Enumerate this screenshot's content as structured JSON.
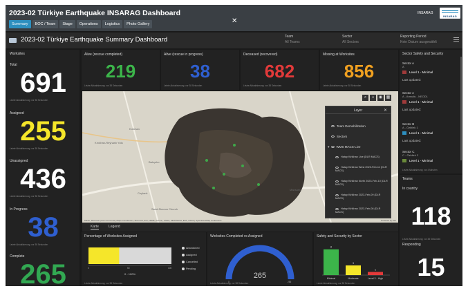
{
  "header": {
    "title": "2023-02 Türkiye Earthquake INSARAG Dashboard",
    "org_label": "INSARAG",
    "logo_text": "INSARAG",
    "tabs": [
      "Summary",
      "BOC / Team",
      "Stage",
      "Operations",
      "Logistics",
      "Photo Gallery"
    ],
    "active_tab": "Summary",
    "close_glyph": "✕"
  },
  "subheader": {
    "title": "2023-02 Türkiye Earthquake Summary Dashboard",
    "filters": [
      {
        "label": "Team",
        "value": "All Teams"
      },
      {
        "label": "Sector",
        "value": "All Sectors"
      },
      {
        "label": "Reporting Period",
        "value": "Kein Datum ausgewählt"
      }
    ]
  },
  "timestamp_text": "Letzte Aktualisierung: vor 38 Sekunden",
  "worksites": {
    "title": "Worksites",
    "blocks": [
      {
        "label": "Total",
        "value": "691",
        "color": "#ffffff"
      },
      {
        "label": "Assigned",
        "value": "255",
        "color": "#f5e62a"
      },
      {
        "label": "Unassigned",
        "value": "436",
        "color": "#ffffff"
      },
      {
        "label": "In Progress",
        "value": "38",
        "color": "#2f5fd0"
      },
      {
        "label": "Complete",
        "value": "265",
        "color": "#32a852"
      }
    ]
  },
  "kpis": [
    {
      "label": "Alive (rescue completed)",
      "value": "219",
      "color": "#3cb54a"
    },
    {
      "label": "Alive (rescue in progress)",
      "value": "38",
      "color": "#2f5fd0"
    },
    {
      "label": "Deceased (recovered)",
      "value": "682",
      "color": "#e23a3a"
    },
    {
      "label": "Missing at Worksites",
      "value": "856",
      "color": "#f0a020"
    }
  ],
  "map": {
    "road_labels": [
      "Kırıkhan",
      "Kırıkhan-Reyhanlı Yolu",
      "Bahçeler",
      "Ceylanlı",
      "Saint-Simeon Church",
      "Mansurlu"
    ],
    "tools": [
      "⌕",
      "⌂",
      "◉",
      "▦"
    ],
    "attribution": "Maxar, Microsoft | Esri Community Maps Contributors, Microsoft, Esri, HERE, Garmin, USGS, METI/NASA, EPA, USDA | OpenStreetMap contributors",
    "powered_by": "Powered by Esri",
    "tabs": [
      "Karte",
      "Legend"
    ],
    "active_tab": "Karte"
  },
  "layer_panel": {
    "title": "Layer",
    "close_glyph": "✕",
    "items": [
      "Team Demobilization",
      "Sectors",
      "WMS MACS-Live"
    ],
    "sub_items": [
      "Hatay Kirikhan Live (DLR MACS)",
      "Hatay Kirikhan West 2023-Feb-11 (DLR MACS)",
      "Hatay Kirikhan North 2023-Feb-10 (DLR MACS)",
      "Hatay Kirikhan 2023-Feb-09 (DLR MACS)",
      "Hatay Kirikhan 2023-Feb-08 (DLR MACS)"
    ]
  },
  "percentage_assigned": {
    "title": "Percentage of Worksites Assigned",
    "axis_ticks": [
      "0",
      "50",
      "100"
    ],
    "axis_caption": "0 - 100%",
    "legend": [
      {
        "label": "Abandoned",
        "color": "#dddddd"
      },
      {
        "label": "Assigned",
        "color": "#ffffff"
      },
      {
        "label": "Cancelled",
        "color": "#dddddd"
      },
      {
        "label": "Pending",
        "color": "#dddddd"
      }
    ],
    "assigned_percent": 37,
    "assigned_color": "#f5e62a",
    "rest_color": "#d9d9d9"
  },
  "completed_gauge": {
    "title": "Worksites Completed vs Assigned",
    "value": 265,
    "value_text": "265",
    "min": 0,
    "max": 255,
    "min_text": "0",
    "max_text": "255",
    "color": "#2f5fd0"
  },
  "safety_by_sector": {
    "title": "Safety and Security by Sector",
    "chart_data": {
      "type": "bar",
      "categories": [
        "Minimal",
        "Moderate",
        "Level 3 - High"
      ],
      "values": [
        8,
        3,
        1
      ],
      "value_labels": [
        "8",
        "3",
        "1"
      ],
      "colors": [
        "#3cb54a",
        "#f5e62a",
        "#e23a3a"
      ],
      "ylim": [
        0,
        9
      ]
    }
  },
  "sector_safety": {
    "title": "Sector Safety and Security",
    "sectors": [
      {
        "name": "Sector A",
        "sub": "A",
        "level": "Level 1 - Minimal",
        "updated": "Last updated:",
        "flag_color": "#a03a3a"
      },
      {
        "name": "Sector A",
        "sub": "A - Armutlu - NEOD1",
        "level": "Level 1 - Minimal",
        "updated": "Last updated:",
        "flag_color": "#a03a3a"
      },
      {
        "name": "Sector B",
        "sub": "A - Özbilek 1",
        "level": "Level 1 - Minimal",
        "updated": "Last updated:",
        "flag_color": "#2d8fbf"
      },
      {
        "name": "Sector C",
        "sub": "C - Özbilek 2",
        "level": "Level 1 - Minimal",
        "updated": "",
        "flag_color": "#6a8a3a"
      }
    ],
    "footer": "Letzte Aktualisierung: vor 4 Minuten"
  },
  "teams": {
    "title": "Teams",
    "blocks": [
      {
        "label": "In country",
        "value": "118",
        "color": "#ffffff"
      },
      {
        "label": "Responding",
        "value": "15",
        "color": "#ffffff"
      }
    ]
  }
}
